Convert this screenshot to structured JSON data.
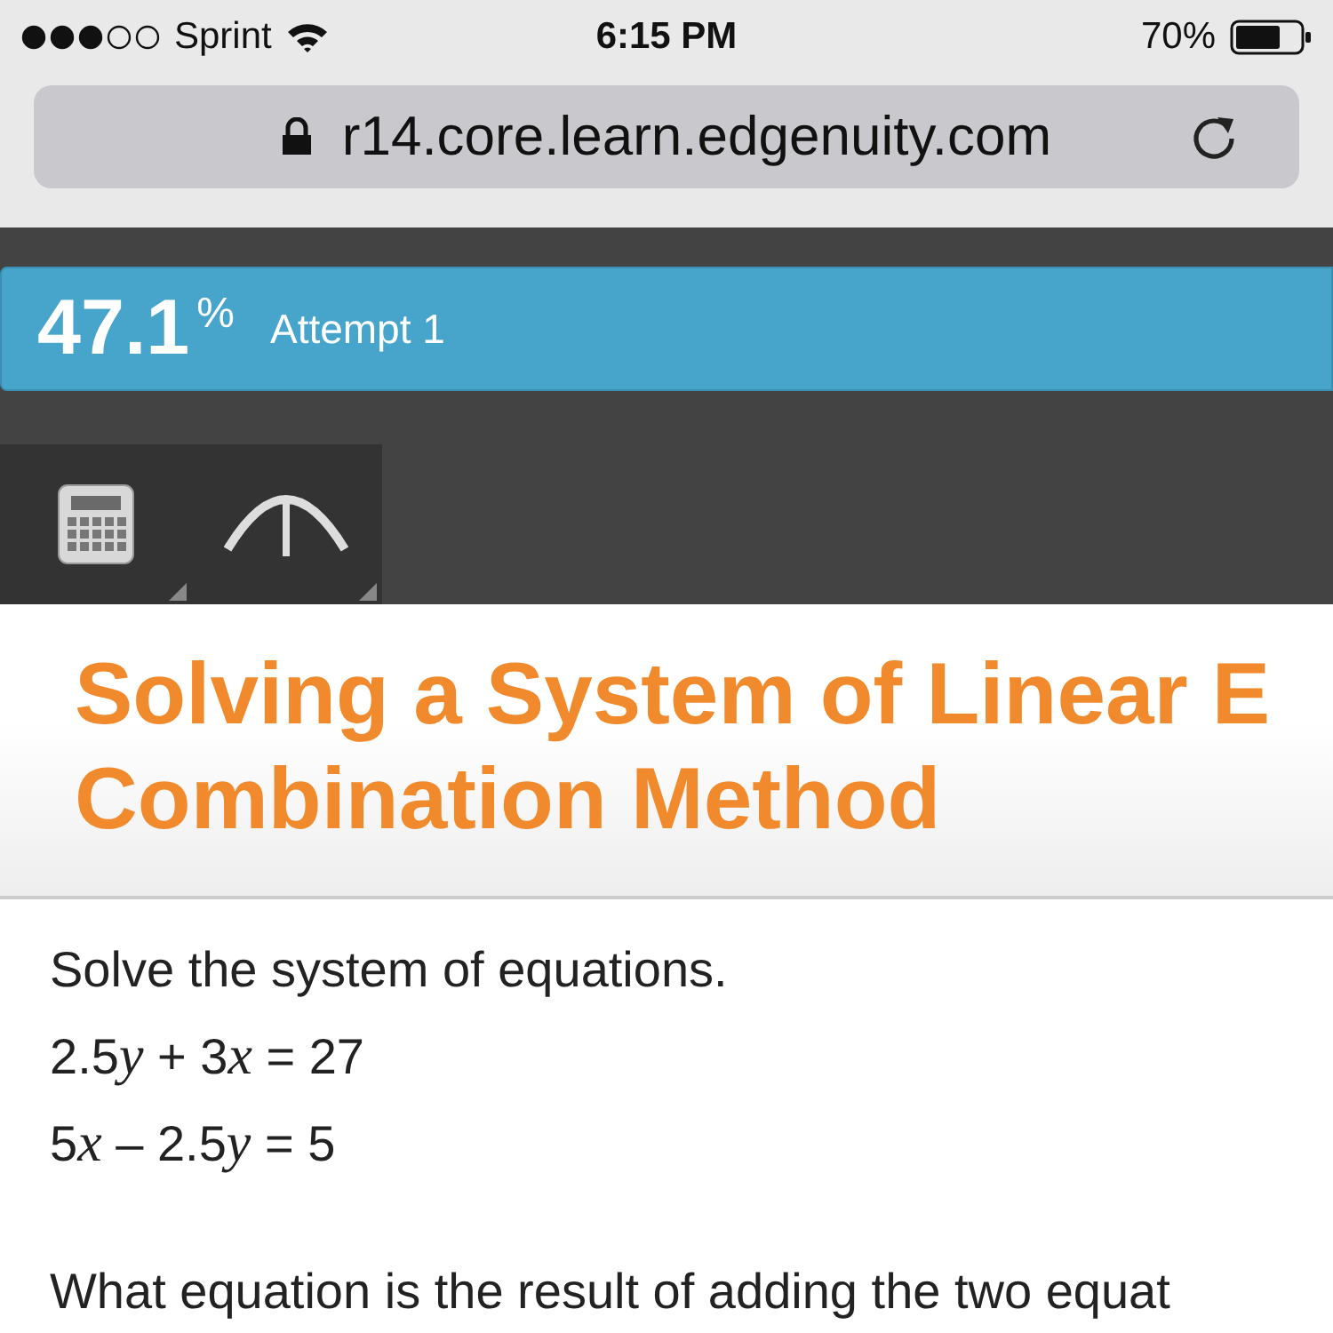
{
  "status_bar": {
    "carrier": "Sprint",
    "time": "6:15 PM",
    "battery": "70%",
    "level": 0.7
  },
  "address_bar": {
    "url": "r14.core.learn.edgenuity.com"
  },
  "score_bar": {
    "score": "47.1",
    "unit": "%",
    "attempt": "Attempt 1"
  },
  "toolbar": [
    {
      "kind": "calculator"
    },
    {
      "kind": "curve"
    }
  ],
  "lesson": {
    "title_lines": [
      "Solving a System of Linear E",
      "Combination Method"
    ]
  },
  "question": {
    "lines": [
      [
        {
          "kind": "text",
          "text": "Solve the system of equations."
        }
      ],
      [
        {
          "kind": "text",
          "text": "2.5"
        },
        {
          "kind": "variable",
          "text": "y"
        },
        {
          "kind": "text",
          "text": " + 3"
        },
        {
          "kind": "variable",
          "text": "x"
        },
        {
          "kind": "text",
          "text": " = 27"
        }
      ],
      [
        {
          "kind": "text",
          "text": "5"
        },
        {
          "kind": "variable",
          "text": "x"
        },
        {
          "kind": "text",
          "text": " – 2.5"
        },
        {
          "kind": "variable",
          "text": "y"
        },
        {
          "kind": "text",
          "text": " = 5"
        }
      ]
    ],
    "prompt": "What equation is the result of adding the two equat"
  }
}
